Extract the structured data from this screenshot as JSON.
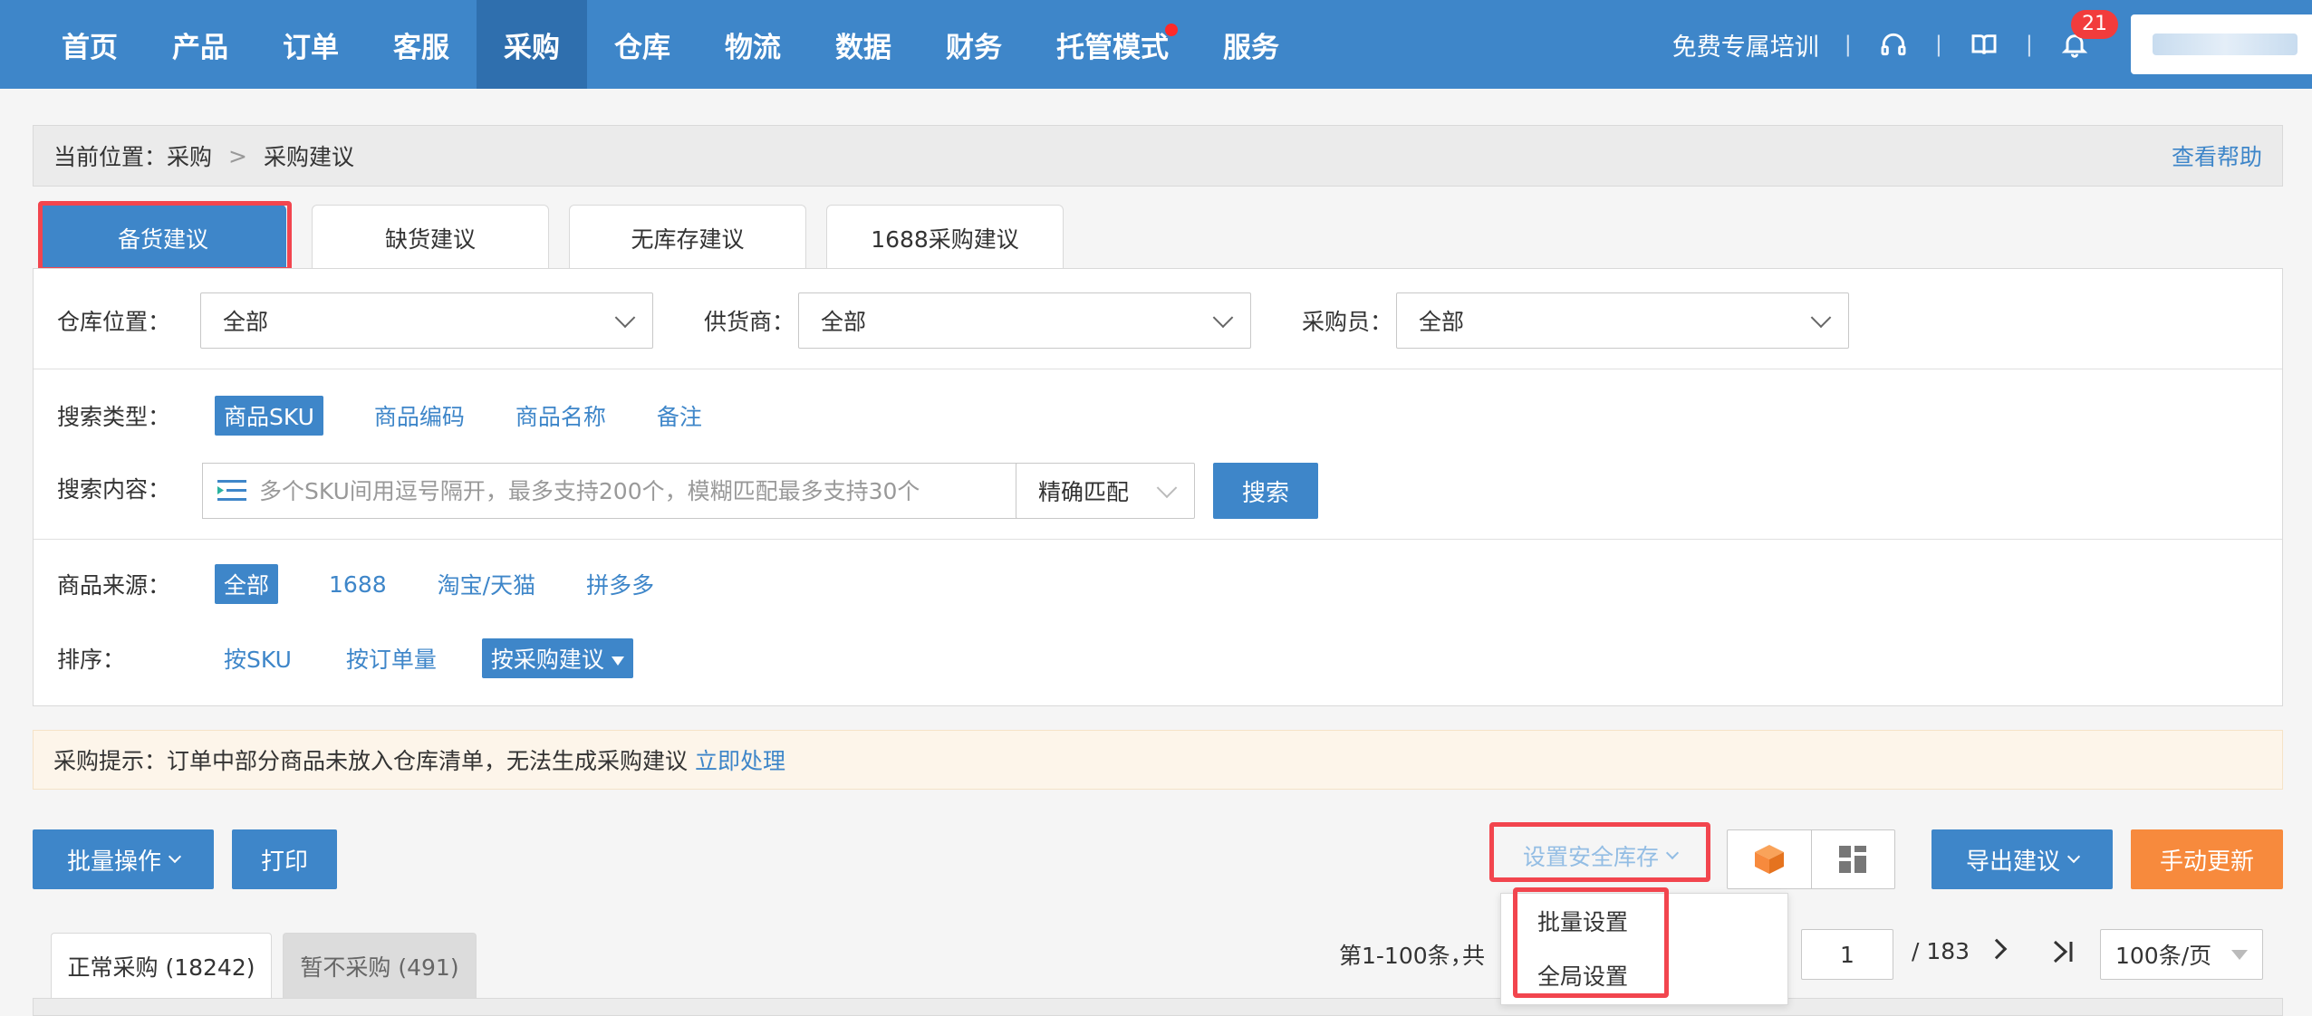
{
  "nav": {
    "items": [
      "首页",
      "产品",
      "订单",
      "客服",
      "采购",
      "仓库",
      "物流",
      "数据",
      "财务",
      "托管模式",
      "服务"
    ],
    "active_index": 4,
    "training_link": "免费专属培训",
    "notification_count": "21"
  },
  "breadcrumb": {
    "prefix": "当前位置：",
    "level1": "采购",
    "separator": ">",
    "level2": "采购建议",
    "help": "查看帮助"
  },
  "tabs": [
    "备货建议",
    "缺货建议",
    "无库存建议",
    "1688采购建议"
  ],
  "filters": {
    "warehouse_label": "仓库位置：",
    "warehouse_value": "全部",
    "supplier_label": "供货商：",
    "supplier_value": "全部",
    "buyer_label": "采购员：",
    "buyer_value": "全部",
    "search_type_label": "搜索类型：",
    "search_types": [
      "商品SKU",
      "商品编码",
      "商品名称",
      "备注"
    ],
    "search_content_label": "搜索内容：",
    "search_placeholder": "多个SKU间用逗号隔开，最多支持200个，模糊匹配最多支持30个",
    "match_mode": "精确匹配",
    "search_button": "搜索",
    "source_label": "商品来源：",
    "sources": [
      "全部",
      "1688",
      "淘宝/天猫",
      "拼多多"
    ],
    "sort_label": "排序：",
    "sorts": [
      "按SKU",
      "按订单量",
      "按采购建议"
    ]
  },
  "notice": {
    "text": "采购提示：订单中部分商品未放入仓库清单，无法生成采购建议",
    "link": "立即处理"
  },
  "toolbar": {
    "batch_ops": "批量操作",
    "print": "打印",
    "safety_stock": "设置安全库存",
    "safety_menu": [
      "批量设置",
      "全局设置"
    ],
    "export": "导出建议",
    "manual_update": "手动更新"
  },
  "list_tabs": {
    "normal": "正常采购 (18242)",
    "paused": "暂不采购 (491)"
  },
  "pager": {
    "range": "第1-100条，",
    "total_prefix": "共",
    "current_page": "1",
    "total_pages": "/ 183",
    "page_size": "100条/页"
  },
  "colors": {
    "primary": "#3e86c9",
    "nav_active": "#2f6fae",
    "orange": "#f78a3d",
    "highlight": "#f2454e"
  }
}
